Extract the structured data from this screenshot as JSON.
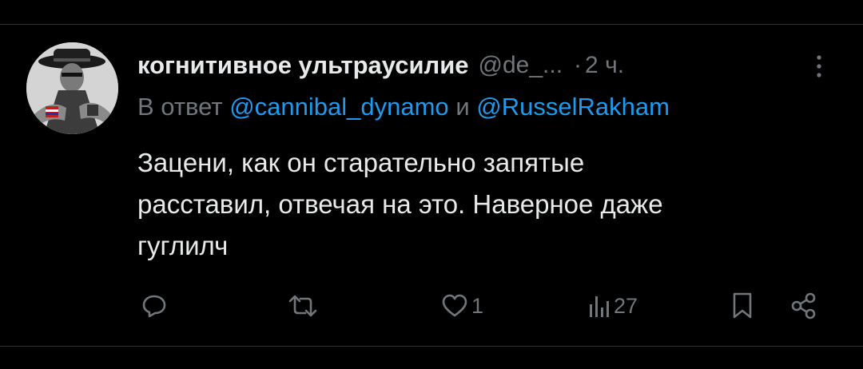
{
  "tweet": {
    "display_name": "когнитивное ультраусилие",
    "handle": "@de_...",
    "separator": "·",
    "time": "2 ч.",
    "reply_prefix": "В ответ",
    "reply_mention_1": "@cannibal_dynamo",
    "reply_conjunction": "и",
    "reply_mention_2": "@RusselRakham",
    "text_line_1": "Зацени, как он старательно запятые",
    "text_line_2": "расставил, отвечая на это. Наверное даже",
    "text_line_3": "гуглилч"
  },
  "actions": {
    "reply_icon": "reply-icon",
    "retweet_icon": "retweet-icon",
    "like_icon": "like-icon",
    "like_count": "1",
    "views_icon": "views-icon",
    "views_count": "27",
    "bookmark_icon": "bookmark-icon",
    "share_icon": "share-icon"
  },
  "colors": {
    "background": "#000000",
    "text": "#e7e9ea",
    "muted": "#71767b",
    "accent": "#1d9bf0",
    "divider": "#2f3336"
  }
}
